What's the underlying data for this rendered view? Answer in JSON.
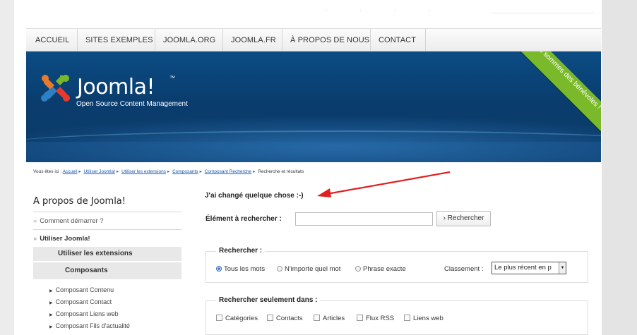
{
  "nav": {
    "items": [
      "ACCUEIL",
      "SITES EXEMPLES",
      "JOOMLA.ORG",
      "JOOMLA.FR",
      "À PROPOS DE NOUS",
      "CONTACT"
    ]
  },
  "header": {
    "logo_text": "Joomla!",
    "logo_tm": "™",
    "tagline": "Open Source Content Management",
    "ribbon": "Nous sommes des bénévoles !"
  },
  "breadcrumb": {
    "prefix": "Vous êtes ici :",
    "links": [
      "Accueil",
      "Utiliser Joomla!",
      "Utiliser les extensions",
      "Composants",
      "Composant Recherche"
    ],
    "current": "Recherche et résultats"
  },
  "sidebar": {
    "title": "A propos de Joomla!",
    "items": [
      "Comment démarrer ?",
      "Utiliser Joomla!"
    ],
    "band1": "Utiliser les extensions",
    "band2": "Composants",
    "subitems": [
      "Composant Contenu",
      "Composant Contact",
      "Composant Liens web",
      "Composant Fils d'actualité"
    ]
  },
  "main": {
    "message": "J'ai changé quelque chose :-)",
    "search_label": "Élément à rechercher :",
    "search_value": "",
    "search_button": "Rechercher",
    "search_button_icon": "›",
    "group1_legend": "Rechercher :",
    "radios": [
      "Tous les mots",
      "N'importe quel mot",
      "Phrase exacte"
    ],
    "order_label": "Classement :",
    "order_value": "Le plus récent en p",
    "group2_legend": "Rechercher seulement dans :",
    "checks": [
      "Catégories",
      "Contacts",
      "Articles",
      "Flux RSS",
      "Liens web"
    ]
  },
  "colors": {
    "header_blue": "#0b4c84",
    "ribbon_green": "#7ab929",
    "arrow_red": "#e02020",
    "link_blue": "#1b57b1"
  }
}
